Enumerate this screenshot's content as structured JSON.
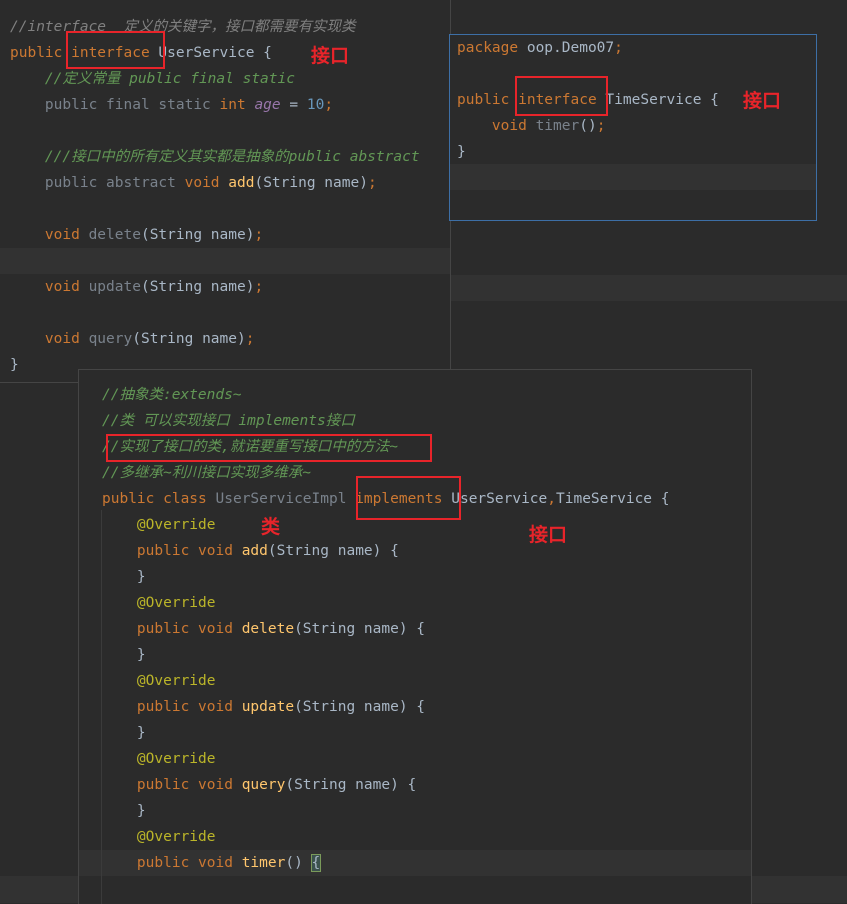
{
  "panel1": {
    "lines": [
      [
        [
          "cmi",
          "//interface  定义的关键字，接口都需要有实现类"
        ]
      ],
      [
        [
          "kw",
          "public "
        ],
        [
          "kw",
          "interface"
        ],
        [
          "tx",
          " UserService {"
        ]
      ],
      [
        [
          "cmb",
          "    //定义常量 public final static"
        ]
      ],
      [
        [
          "gray",
          "    public final static "
        ],
        [
          "kw",
          "int "
        ],
        [
          "var",
          "age"
        ],
        [
          "tx",
          " = "
        ],
        [
          "num",
          "10"
        ],
        [
          "kw",
          ";"
        ]
      ],
      [
        [
          "tx",
          ""
        ]
      ],
      [
        [
          "cmb",
          "    ///接口中的所有定义其实都是抽象的public abstract"
        ]
      ],
      [
        [
          "gray",
          "    public abstract "
        ],
        [
          "kw",
          "void "
        ],
        [
          "fn",
          "add"
        ],
        [
          "tx",
          "(String name)"
        ],
        [
          "kw",
          ";"
        ]
      ],
      [
        [
          "tx",
          ""
        ]
      ],
      [
        [
          "kw",
          "    void "
        ],
        [
          "gray",
          "delete"
        ],
        [
          "tx",
          "(String name)"
        ],
        [
          "kw",
          ";"
        ]
      ],
      [
        [
          "tx",
          ""
        ]
      ],
      [
        [
          "kw",
          "    void "
        ],
        [
          "gray",
          "update"
        ],
        [
          "tx",
          "(String name)"
        ],
        [
          "kw",
          ";"
        ]
      ],
      [
        [
          "tx",
          ""
        ]
      ],
      [
        [
          "kw",
          "    void "
        ],
        [
          "gray",
          "query"
        ],
        [
          "tx",
          "(String name)"
        ],
        [
          "kw",
          ";"
        ]
      ],
      [
        [
          "tx",
          "}"
        ]
      ]
    ],
    "label": "接口"
  },
  "panel2": {
    "lines": [
      [
        [
          "kw",
          "package "
        ],
        [
          "tx",
          "oop.Demo07"
        ],
        [
          "kw",
          ";"
        ]
      ],
      [
        [
          "tx",
          ""
        ]
      ],
      [
        [
          "kw",
          "public "
        ],
        [
          "kw",
          "interface"
        ],
        [
          "tx",
          " TimeService {"
        ]
      ],
      [
        [
          "kw",
          "    void "
        ],
        [
          "gray",
          "timer"
        ],
        [
          "tx",
          "()"
        ],
        [
          "kw",
          ";"
        ]
      ],
      [
        [
          "tx",
          "}"
        ]
      ]
    ],
    "label": "接口"
  },
  "panel3": {
    "lines": [
      [
        [
          "cmb",
          "//抽象类:extends~"
        ]
      ],
      [
        [
          "cmb",
          "//类 可以实现接口 implements接口"
        ]
      ],
      [
        [
          "cmb",
          "//实现了接口的类,就诺要重写接口中的方法~"
        ]
      ],
      [
        [
          "cmb",
          "//多继承~利川接口实现多维承~"
        ]
      ],
      [
        [
          "kw",
          "public class "
        ],
        [
          "gray",
          "UserServiceImpl "
        ],
        [
          "kw",
          "implements"
        ],
        [
          "tx",
          " UserService"
        ],
        [
          "kw",
          ","
        ],
        [
          "tx",
          "TimeService {"
        ]
      ],
      [
        [
          "ann",
          "    @Override"
        ]
      ],
      [
        [
          "kw",
          "    public void "
        ],
        [
          "fn",
          "add"
        ],
        [
          "tx",
          "(String name) {"
        ]
      ],
      [
        [
          "tx",
          "    }"
        ]
      ],
      [
        [
          "ann",
          "    @Override"
        ]
      ],
      [
        [
          "kw",
          "    public void "
        ],
        [
          "fn",
          "delete"
        ],
        [
          "tx",
          "(String name) {"
        ]
      ],
      [
        [
          "tx",
          "    }"
        ]
      ],
      [
        [
          "ann",
          "    @Override"
        ]
      ],
      [
        [
          "kw",
          "    public void "
        ],
        [
          "fn",
          "update"
        ],
        [
          "tx",
          "(String name) {"
        ]
      ],
      [
        [
          "tx",
          "    }"
        ]
      ],
      [
        [
          "ann",
          "    @Override"
        ]
      ],
      [
        [
          "kw",
          "    public void "
        ],
        [
          "fn",
          "query"
        ],
        [
          "tx",
          "(String name) {"
        ]
      ],
      [
        [
          "tx",
          "    }"
        ]
      ],
      [
        [
          "ann",
          "    @Override"
        ]
      ],
      [
        [
          "kw",
          "    public void "
        ],
        [
          "fn",
          "timer"
        ],
        [
          "tx",
          "() "
        ],
        [
          "caret",
          "{"
        ]
      ]
    ],
    "label_class": "类",
    "label_interface": "接口"
  }
}
